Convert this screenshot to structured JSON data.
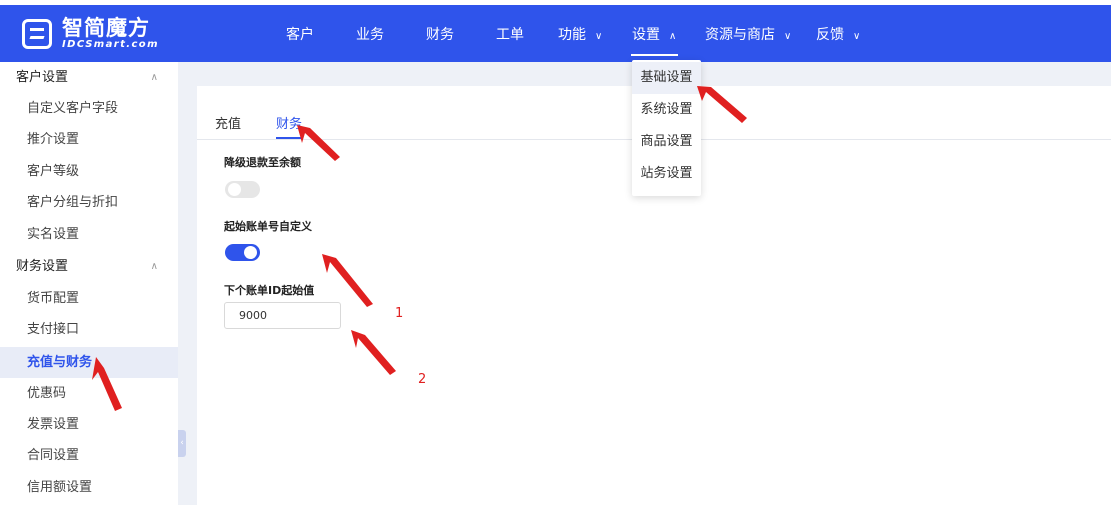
{
  "logo": {
    "cn": "智简魔方",
    "en": "IDCSmart.com"
  },
  "nav": {
    "items": [
      {
        "label": "客户",
        "has_caret": false
      },
      {
        "label": "业务",
        "has_caret": false
      },
      {
        "label": "财务",
        "has_caret": false
      },
      {
        "label": "工单",
        "has_caret": false
      },
      {
        "label": "功能",
        "has_caret": true,
        "caret": "∨"
      },
      {
        "label": "设置",
        "has_caret": true,
        "caret": "∧",
        "active": true
      },
      {
        "label": "资源与商店",
        "has_caret": true,
        "caret": "∨"
      },
      {
        "label": "反馈",
        "has_caret": true,
        "caret": "∨"
      }
    ]
  },
  "settings_dropdown": {
    "items": [
      "基础设置",
      "系统设置",
      "商品设置",
      "站务设置"
    ],
    "active_index": 0
  },
  "sidebar": {
    "groups": [
      {
        "title": "客户设置",
        "caret": "∧",
        "items": [
          "自定义客户字段",
          "推介设置",
          "客户等级",
          "客户分组与折扣",
          "实名设置"
        ]
      },
      {
        "title": "财务设置",
        "caret": "∧",
        "items": [
          "货币配置",
          "支付接口",
          "充值与财务",
          "优惠码",
          "发票设置",
          "合同设置",
          "信用额设置"
        ]
      }
    ],
    "active_item": "充值与财务",
    "collapse_glyph": "‹"
  },
  "main": {
    "tabs": [
      {
        "label": "充值",
        "active": false
      },
      {
        "label": "财务",
        "active": true
      }
    ],
    "fields": {
      "downgrade_refund": {
        "label": "降级退款至余额",
        "enabled": false
      },
      "custom_invoice_start": {
        "label": "起始账单号自定义",
        "enabled": true
      },
      "next_invoice_id": {
        "label": "下个账单ID起始值",
        "value": "9000"
      }
    }
  },
  "annotations": {
    "num1": "1",
    "num2": "2",
    "arrow_color": "#e02020"
  },
  "colors": {
    "primary": "#2f54eb",
    "annotation": "#e02020"
  }
}
